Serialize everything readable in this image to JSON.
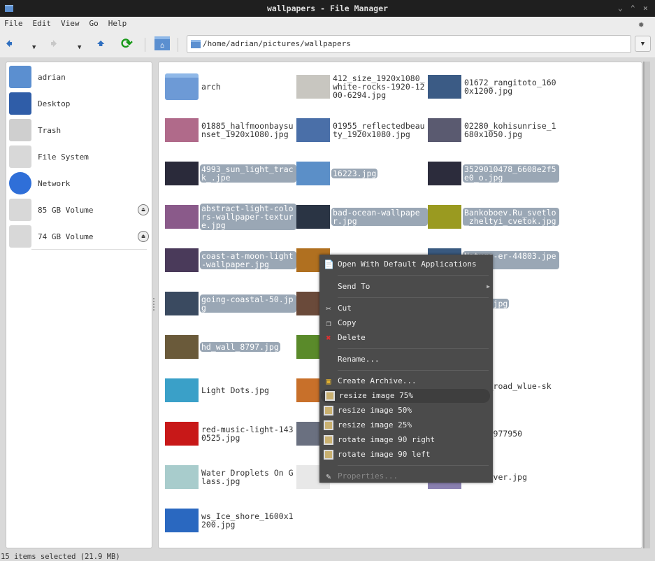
{
  "window": {
    "title": "wallpapers - File Manager"
  },
  "menubar": [
    "File",
    "Edit",
    "View",
    "Go",
    "Help"
  ],
  "toolbar": {
    "back": "back-icon",
    "forward": "forward-icon",
    "up": "up-icon",
    "reload": "reload-icon",
    "home": "home-folder-icon"
  },
  "address": {
    "path": "/home/adrian/pictures/wallpapers"
  },
  "sidebar": {
    "items": [
      {
        "label": "adrian",
        "icon": "home-folder-icon",
        "color": "#5b8fd0"
      },
      {
        "label": "Desktop",
        "icon": "desktop-icon",
        "color": "#2f5da8"
      },
      {
        "label": "Trash",
        "icon": "trash-icon",
        "color": "#cfcfcf"
      },
      {
        "label": "File System",
        "icon": "drive-icon",
        "color": "#d8d8d8"
      },
      {
        "label": "Network",
        "icon": "globe-icon",
        "color": "#2f6fd8"
      },
      {
        "label": "85 GB Volume",
        "icon": "drive-icon",
        "color": "#d8d8d8",
        "eject": true
      },
      {
        "label": "74 GB Volume",
        "icon": "drive-icon",
        "color": "#d8d8d8",
        "eject": true
      }
    ]
  },
  "files": [
    {
      "name": "arch",
      "folder": true,
      "selected": false,
      "color": "#6d9ad6"
    },
    {
      "name": "412_size_1920x1080_white-rocks-1920-1200-6294.jpg",
      "selected": false,
      "color": "#c8c6c0"
    },
    {
      "name": "01672_rangitoto_1600x1200.jpg",
      "selected": false,
      "color": "#3b5b85"
    },
    {
      "name": "01885_halfmoonbaysunset_1920x1080.jpg",
      "selected": false,
      "color": "#b06a8a"
    },
    {
      "name": "01955_reflectedbeauty_1920x1080.jpg",
      "selected": false,
      "color": "#4a6fa8"
    },
    {
      "name": "02280_kohisunrise_1680x1050.jpg",
      "selected": false,
      "color": "#5a5a70"
    },
    {
      "name": "4993_sun_light_track_.jpe",
      "selected": true,
      "color": "#2a2a3a"
    },
    {
      "name": "16223.jpg",
      "selected": true,
      "color": "#5b8fc8"
    },
    {
      "name": "3529010478_6608e2f5e0_o.jpg",
      "selected": true,
      "color": "#2c2c3c"
    },
    {
      "name": "abstract-light-colors-wallpaper-texture.jpg",
      "selected": true,
      "color": "#8a5a8a"
    },
    {
      "name": "bad-ocean-wallpaper.jpg",
      "selected": true,
      "color": "#2a3444"
    },
    {
      "name": "Bankoboev.Ru_svetlo_zheltyi_cvetok.jpg",
      "selected": true,
      "color": "#9a9a20"
    },
    {
      "name": "coast-at-moon-light-wallpaper.jpg",
      "selected": true,
      "color": "#4a3a5a"
    },
    {
      "name": "",
      "selected": false,
      "color": "#b07020"
    },
    {
      "name": "Nature-er-44803.jpeg",
      "selected": true,
      "color": "#3a5a80"
    },
    {
      "name": "going-coastal-50.jpg",
      "selected": true,
      "color": "#3a4a60"
    },
    {
      "name": "",
      "selected": false,
      "color": "#6a4a3a"
    },
    {
      "name": "_5659.jpg",
      "selected": true,
      "color": "#3a4a5a"
    },
    {
      "name": "hd_wall_8797.jpg",
      "selected": true,
      "color": "#6a5a3a"
    },
    {
      "name": "",
      "selected": false,
      "color": "#5a8a2a"
    },
    {
      "name": "g",
      "selected": true,
      "color": "#ffffff"
    },
    {
      "name": "Light Dots.jpg",
      "selected": false,
      "color": "#3aa0c8"
    },
    {
      "name": "",
      "selected": false,
      "color": "#c8702a"
    },
    {
      "name": "untry_road_wlue-sky.jpg",
      "selected": false,
      "color": "#ffffff"
    },
    {
      "name": "red-music-light-1430525.jpg",
      "selected": false,
      "color": "#c81818"
    },
    {
      "name": "",
      "selected": false,
      "color": "#6a7080"
    },
    {
      "name": "stock_977950",
      "selected": false,
      "color": "#ffffff"
    },
    {
      "name": "Water Droplets On Glass.jpg",
      "selected": false,
      "color": "#a8cccc"
    },
    {
      "name": "jpg",
      "selected": false,
      "color": "#e8e8e8"
    },
    {
      "name": "and-river.jpg",
      "selected": false,
      "color": "#8a80b0"
    },
    {
      "name": "ws_Ice_shore_1600x1200.jpg",
      "selected": false,
      "color": "#2a68c0"
    }
  ],
  "context_menu": {
    "items": [
      {
        "label": "Open With Default Applications",
        "icon": "open-with-icon"
      },
      {
        "separator": true
      },
      {
        "label": "Send To",
        "submenu": true
      },
      {
        "separator": true
      },
      {
        "label": "Cut",
        "icon": "scissors-icon"
      },
      {
        "label": "Copy",
        "icon": "copy-icon"
      },
      {
        "label": "Delete",
        "icon": "delete-icon"
      },
      {
        "separator": true
      },
      {
        "label": "Rename..."
      },
      {
        "separator": true
      },
      {
        "label": "Create Archive...",
        "icon": "archive-icon"
      },
      {
        "label": "resize image 75%",
        "icon": "image-icon",
        "highlighted": true
      },
      {
        "label": "resize image 50%",
        "icon": "image-icon"
      },
      {
        "label": "resize image 25%",
        "icon": "image-icon"
      },
      {
        "label": "rotate image 90 right",
        "icon": "image-icon"
      },
      {
        "label": "rotate image 90 left",
        "icon": "image-icon"
      },
      {
        "separator": true
      },
      {
        "label": "Properties...",
        "icon": "properties-icon",
        "disabled": true
      }
    ]
  },
  "status": "15 items selected (21.9 MB)"
}
